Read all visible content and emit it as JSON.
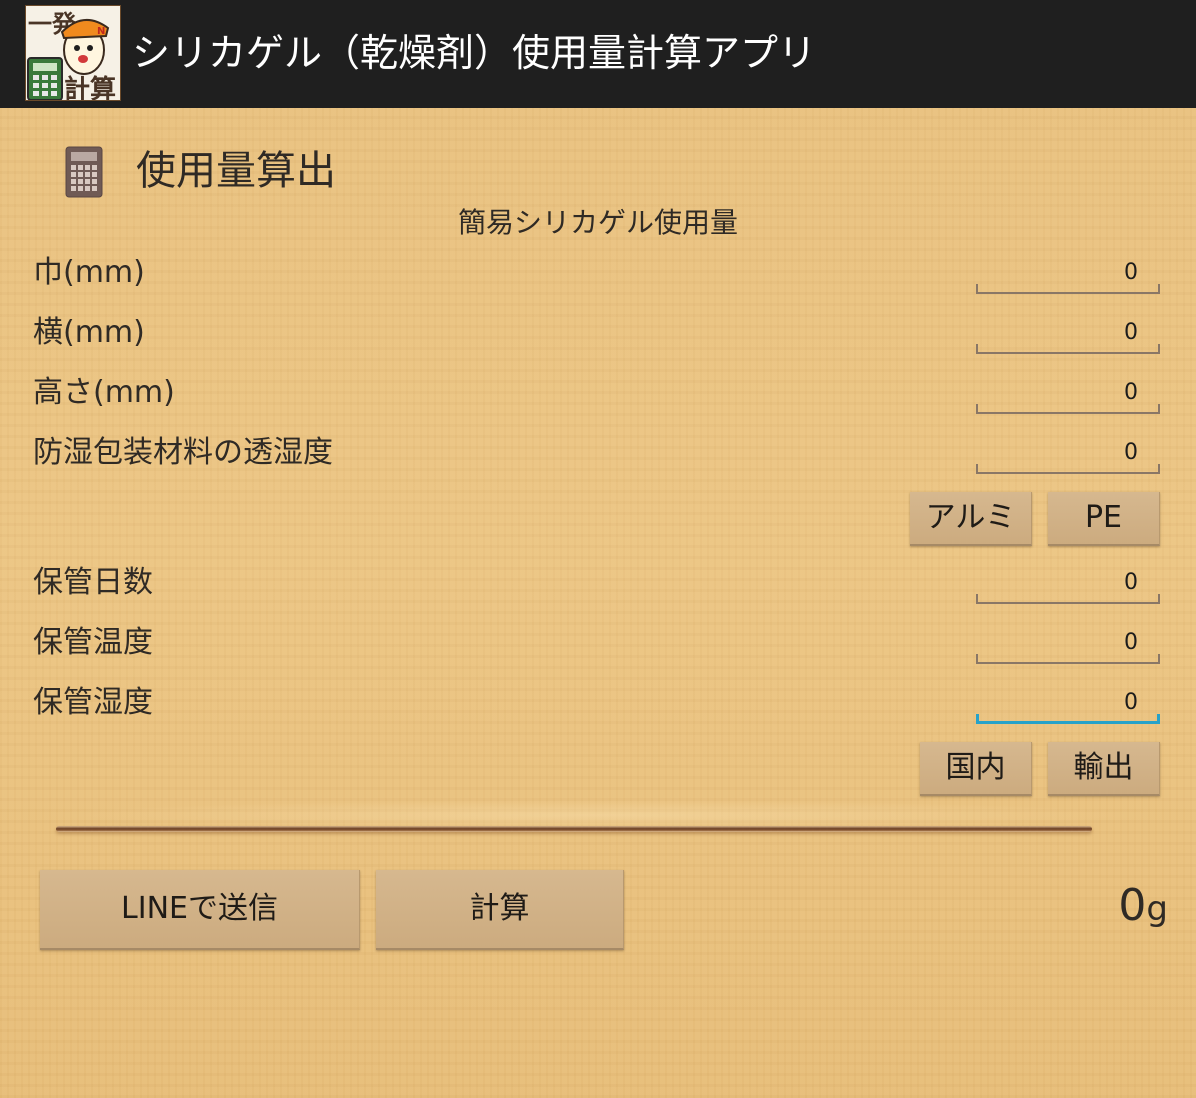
{
  "appbar": {
    "title": "シリカゲル（乾燥剤）使用量計算アプリ",
    "logo_text_top": "一発",
    "logo_text_bottom": "計算"
  },
  "section": {
    "icon": "calculator-icon",
    "title": "使用量算出",
    "subtitle": "簡易シリカゲル使用量"
  },
  "fields": {
    "width": {
      "label": "巾(mm)",
      "value": "0"
    },
    "length": {
      "label": "横(mm)",
      "value": "0"
    },
    "height": {
      "label": "高さ(mm)",
      "value": "0"
    },
    "permeability": {
      "label": "防湿包装材料の透湿度",
      "value": "0"
    },
    "days": {
      "label": "保管日数",
      "value": "0"
    },
    "temperature": {
      "label": "保管温度",
      "value": "0"
    },
    "humidity": {
      "label": "保管湿度",
      "value": "0"
    }
  },
  "material_buttons": {
    "aluminum": "アルミ",
    "pe": "PE"
  },
  "region_buttons": {
    "domestic": "国内",
    "export": "輸出"
  },
  "actions": {
    "send_line": "LINEで送信",
    "calculate": "計算"
  },
  "result": {
    "value": "0",
    "unit": "g"
  },
  "colors": {
    "appbar_bg": "#1f1f1f",
    "background": "#e8bf7c",
    "button": "#d1b287",
    "focus_accent": "#27a2c9"
  }
}
